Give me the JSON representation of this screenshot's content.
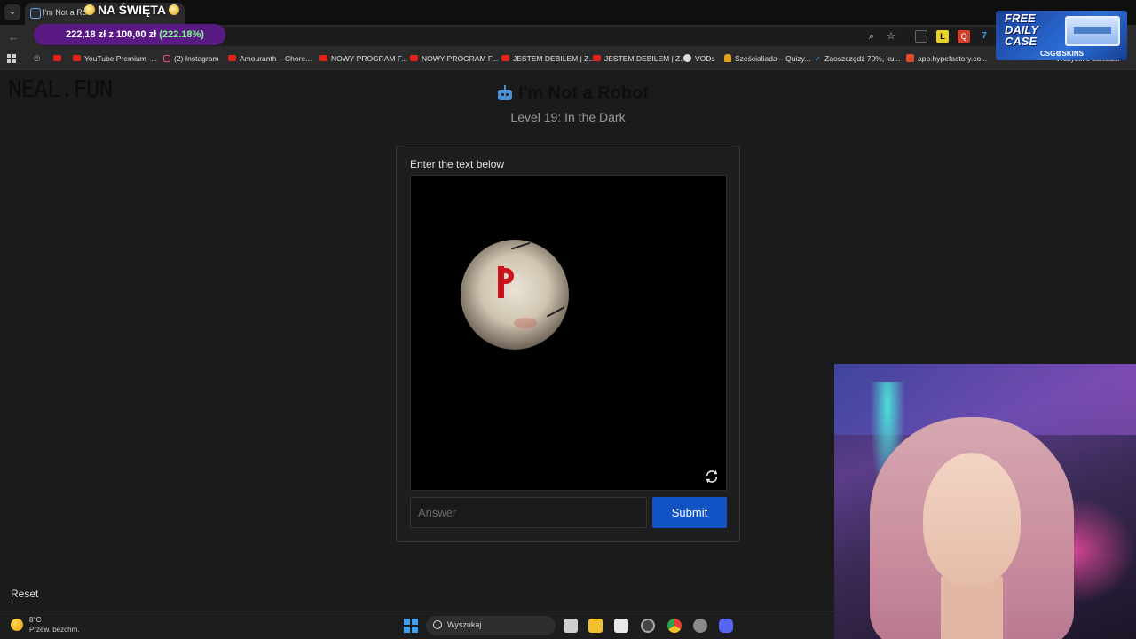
{
  "browser": {
    "tab_title": "I'm Not a Ro",
    "overlay_title": "NA ŚWIĘTA",
    "donation": {
      "amount_text": "222,18 zł z 100,00 zł",
      "percent_text": "(222.18%)",
      "progress_fraction": 2.2218
    },
    "bookmarks": [
      {
        "label": "YouTube Premium -...",
        "icon": "youtube-icon"
      },
      {
        "label": "(2) Instagram",
        "icon": "instagram-icon"
      },
      {
        "label": "Amouranth – Chore...",
        "icon": "youtube-icon"
      },
      {
        "label": "NOWY PROGRAM F...",
        "icon": "youtube-icon"
      },
      {
        "label": "NOWY PROGRAM F...",
        "icon": "youtube-icon"
      },
      {
        "label": "JESTEM DEBILEM | Z...",
        "icon": "youtube-icon"
      },
      {
        "label": "JESTEM DEBILEM | Z...",
        "icon": "youtube-icon"
      },
      {
        "label": "VODs",
        "icon": "globe-icon"
      },
      {
        "label": "Sześcialiada – Quizy...",
        "icon": "quiz-icon"
      },
      {
        "label": "Zaoszczędź 70%, ku...",
        "icon": "steam-icon"
      },
      {
        "label": "app.hypefactory.co...",
        "icon": "hypefactory-icon"
      }
    ],
    "bookmarks_overflow": "Wszystkie zakładki"
  },
  "ad": {
    "line1": "FREE",
    "line2": "DAILY",
    "line3": "CASE",
    "brand": "CSG⚙SKINS"
  },
  "page": {
    "logo": "NEAL.FUN",
    "game_title": "I'm Not a Robot",
    "level_title": "Level 19: In the Dark",
    "captcha": {
      "instruction": "Enter the text below",
      "answer_placeholder": "Answer",
      "submit_label": "Submit"
    },
    "reset_label": "Reset",
    "colors": {
      "submit": "#1153c4",
      "robot_icon": "#4c8fd6",
      "captcha_char": "#c8141a"
    }
  },
  "taskbar": {
    "weather_temp": "8°C",
    "weather_desc": "Przew. bezchm.",
    "search_label": "Wyszukaj"
  }
}
